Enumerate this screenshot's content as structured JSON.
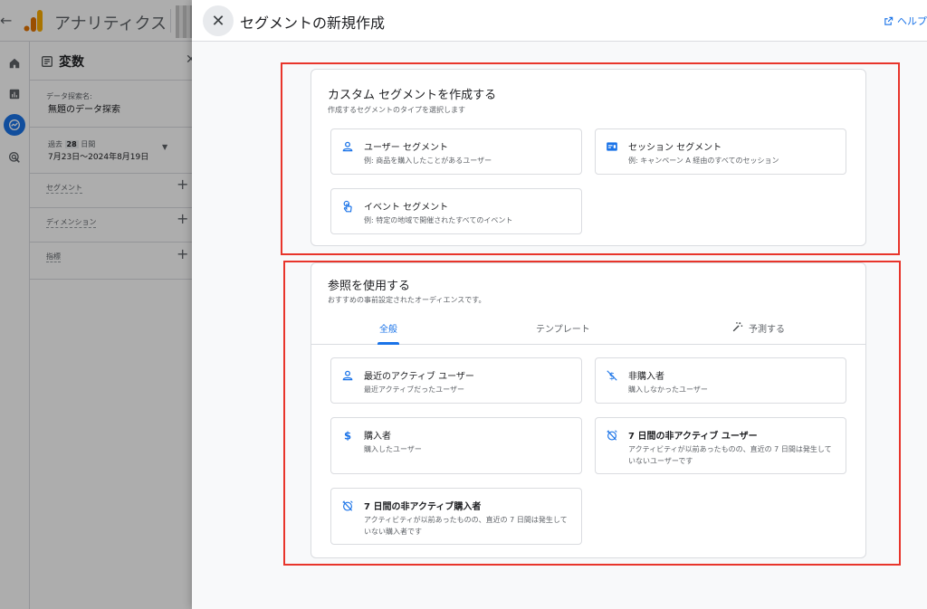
{
  "app": {
    "title": "アナリティクス",
    "panel_title": "変数",
    "explore_name_label": "データ探索名:",
    "explore_name": "無題のデータ探索",
    "date_prefix": "過去",
    "date_days": "28",
    "date_suffix": "日間",
    "date_range": "7月23日～2024年8月19日",
    "sections": [
      {
        "label": "セグメント"
      },
      {
        "label": "ディメンション"
      },
      {
        "label": "指標"
      }
    ]
  },
  "dialog": {
    "title": "セグメントの新規作成",
    "help": "ヘルプ"
  },
  "custom": {
    "title": "カスタム セグメントを作成する",
    "subtitle": "作成するセグメントのタイプを選択します",
    "options": [
      {
        "title": "ユーザー セグメント",
        "desc": "例: 商品を購入したことがあるユーザー",
        "icon": "person-icon"
      },
      {
        "title": "セッション セグメント",
        "desc": "例: キャンペーン A 経由のすべてのセッション",
        "icon": "session-icon"
      },
      {
        "title": "イベント セグメント",
        "desc": "例: 特定の地域で開催されたすべてのイベント",
        "icon": "touch-icon"
      }
    ]
  },
  "reference": {
    "title": "参照を使用する",
    "subtitle": "おすすめの事前設定されたオーディエンスです。",
    "tabs": [
      {
        "label": "全般"
      },
      {
        "label": "テンプレート"
      },
      {
        "label": "予測する"
      }
    ],
    "options": [
      {
        "title": "最近のアクティブ ユーザー",
        "desc": "最近アクティブだったユーザー",
        "icon": "person-icon"
      },
      {
        "title": "非購入者",
        "desc": "購入しなかったユーザー",
        "icon": "no-money-icon"
      },
      {
        "title": "購入者",
        "desc": "購入したユーザー",
        "icon": "dollar-icon"
      },
      {
        "title": "7 日間の非アクティブ ユーザー",
        "desc": "アクティビティが以前あったものの、直近の 7 日間は発生していないユーザーです",
        "icon": "alarm-off-icon"
      },
      {
        "title": "7 日間の非アクティブ購入者",
        "desc": "アクティビティが以前あったものの、直近の 7 日間は発生していない購入者です",
        "icon": "alarm-off-icon"
      }
    ]
  },
  "colors": {
    "accent": "#1a73e8",
    "highlight": "#e8352b",
    "logo_orange": "#f9ab00",
    "logo_dark": "#e37400"
  }
}
